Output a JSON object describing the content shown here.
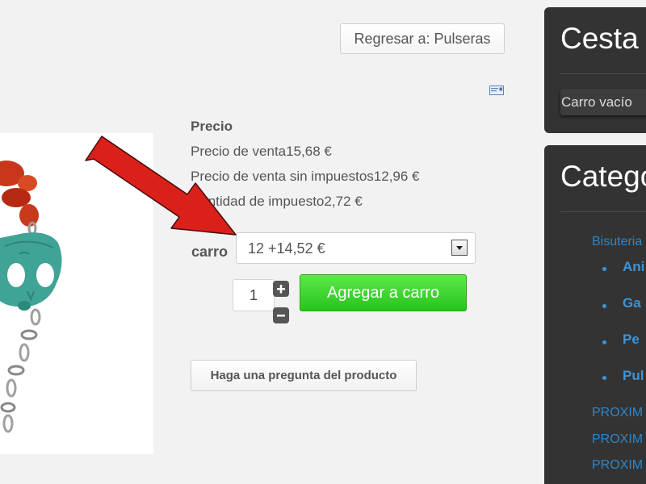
{
  "nav": {
    "back_label": "Regresar a: Pulseras"
  },
  "icons": {
    "email": "email-icon",
    "plus": "plus-icon",
    "minus": "minus-icon",
    "dropdown": "chevron-down-icon",
    "arrow": "red-arrow-pointer"
  },
  "price": {
    "title": "Precio",
    "sale_label": "Precio de venta",
    "sale_value": "15,68 €",
    "net_label": "Precio de venta sin impuestos",
    "net_value": "12,96 €",
    "tax_label": "Cantidad de impuesto",
    "tax_value": "2,72 €"
  },
  "cart_options": {
    "label": "carro",
    "selected": "12 +14,52 €"
  },
  "quantity": {
    "value": "1"
  },
  "actions": {
    "add_to_cart": "Agregar a carro",
    "ask_question": "Haga una pregunta del producto"
  },
  "sidebar": {
    "cart": {
      "title": "Cesta",
      "empty_text": "Carro vacío"
    },
    "categories": {
      "title": "Catego",
      "parent": "Bisuteria",
      "children": [
        "Ani",
        "Ga",
        "Pe",
        "Pul"
      ],
      "links": [
        "PROXIM",
        "PROXIM",
        "PROXIM"
      ]
    }
  },
  "colors": {
    "page_bg": "#f2f2f2",
    "sidebar_bg": "#333333",
    "link_blue": "#3b95db",
    "add_button_green": "#2cc820",
    "arrow_red": "#d9201b"
  }
}
